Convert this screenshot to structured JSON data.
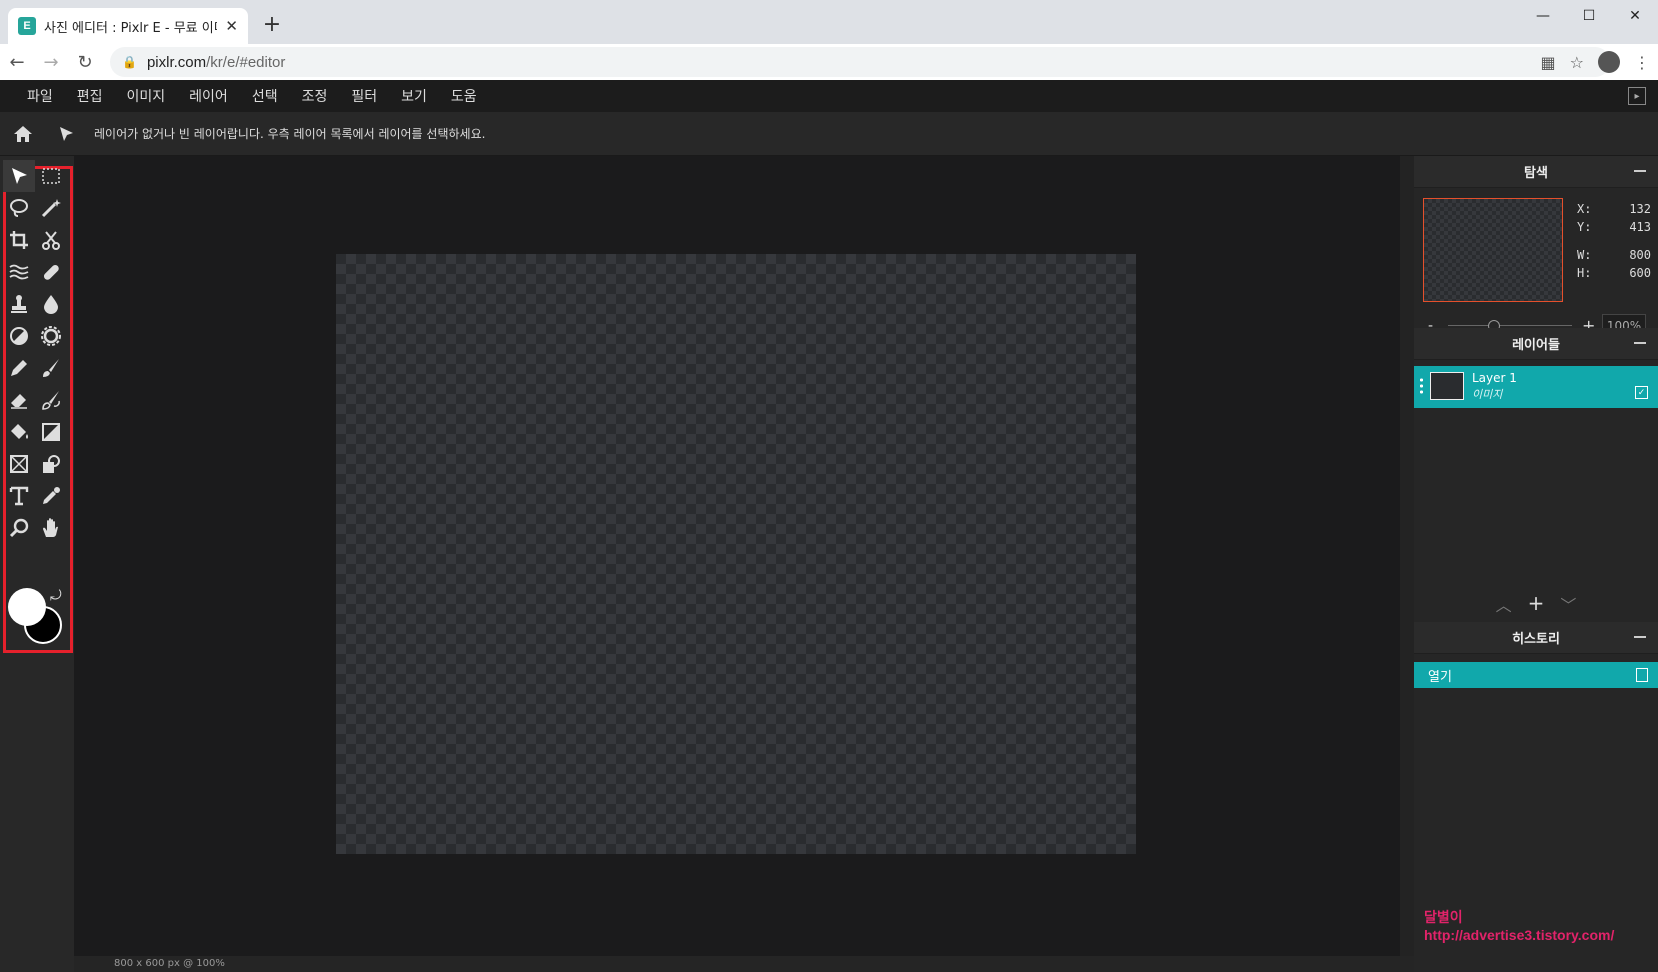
{
  "browser": {
    "tab_title": "사진 에디터 : Pixlr E - 무료 이미",
    "favicon_letter": "E",
    "new_tab": "+",
    "url_host": "pixlr.com",
    "url_path": "/kr/e/#editor"
  },
  "menu": [
    "파일",
    "편집",
    "이미지",
    "레이어",
    "선택",
    "조정",
    "필터",
    "보기",
    "도움"
  ],
  "options": {
    "message": "레이어가 없거나 빈 레이어랍니다. 우측 레이어 목록에서 레이어를 선택하세요."
  },
  "status": {
    "text": "800 x 600 px @ 100%"
  },
  "navigator": {
    "title": "탐색",
    "x_label": "X:",
    "x": "132",
    "y_label": "Y:",
    "y": "413",
    "w_label": "W:",
    "w": "800",
    "h_label": "H:",
    "h": "600",
    "zoom_minus": "-",
    "zoom_plus": "+",
    "zoom_value": "100%"
  },
  "layers": {
    "title": "레이어들",
    "items": [
      {
        "name": "Layer 1",
        "type": "이미지"
      }
    ]
  },
  "history": {
    "title": "히스토리",
    "items": [
      {
        "label": "열기"
      }
    ]
  },
  "watermark": {
    "line1": "달별이",
    "line2": "http://advertise3.tistory.com/"
  },
  "colors": {
    "accent": "#11a8ab",
    "highlight": "#e5212c"
  }
}
